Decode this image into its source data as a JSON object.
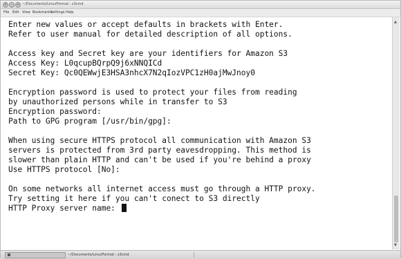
{
  "window": {
    "title": "~/Documents/LinuxFormat : s3cmd",
    "buttons": [
      "×",
      "–",
      "+"
    ]
  },
  "menubar": {
    "items": [
      "File",
      "Edit",
      "View",
      "Bookmarks",
      "Settings",
      "Help"
    ]
  },
  "terminal": {
    "lines": [
      "Enter new values or accept defaults in brackets with Enter.",
      "Refer to user manual for detailed description of all options.",
      "",
      "Access key and Secret key are your identifiers for Amazon S3",
      "Access Key: L0qcupBQrpQ9j6xNNQICd",
      "Secret Key: Qc0QEWwjE3HSA3nhcX7N2qIozVPC1zH0ajMwJnoy0",
      "",
      "Encryption password is used to protect your files from reading",
      "by unauthorized persons while in transfer to S3",
      "Encryption password:",
      "Path to GPG program [/usr/bin/gpg]:",
      "",
      "When using secure HTTPS protocol all communication with Amazon S3",
      "servers is protected from 3rd party eavesdropping. This method is",
      "slower than plain HTTP and can't be used if you're behind a proxy",
      "Use HTTPS protocol [No]:",
      "",
      "On some networks all internet access must go through a HTTP proxy.",
      "Try setting it here if you can't conect to S3 directly",
      "HTTP Proxy server name: "
    ]
  },
  "statusbar": {
    "tab_label": "~/Documents/LinuxFormat : s3cmd"
  }
}
